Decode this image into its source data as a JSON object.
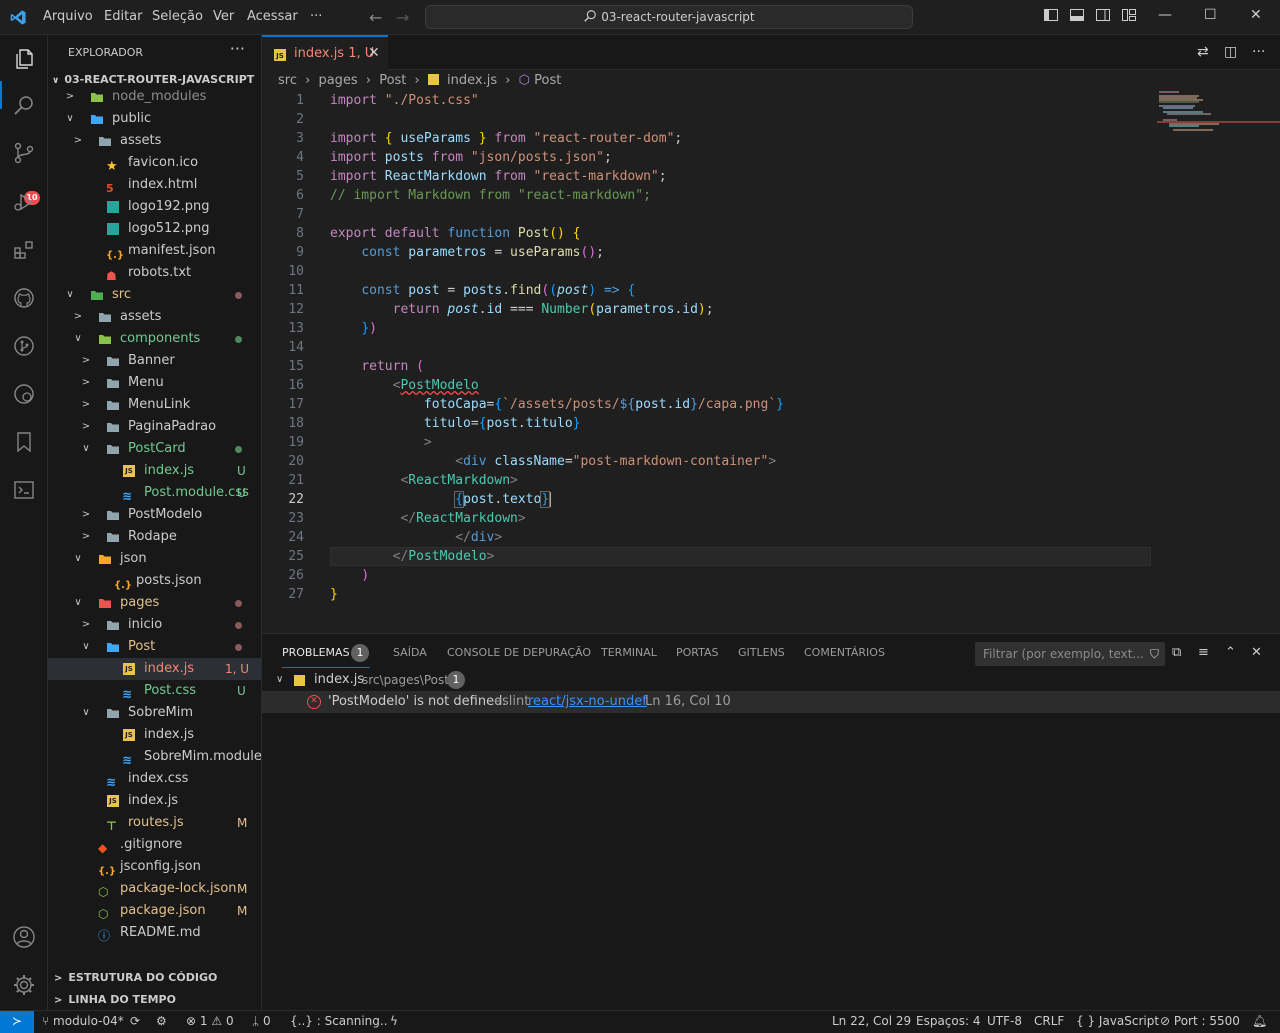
{
  "titlebar": {
    "menu": [
      "Arquivo",
      "Editar",
      "Seleção",
      "Ver",
      "Acessar"
    ],
    "more": "···",
    "command_center": "03-react-router-javascript"
  },
  "activity": {
    "scm_badge": "10"
  },
  "sidebar": {
    "title": "EXPLORADOR",
    "root": "03-REACT-ROUTER-JAVASCRIPT",
    "tree": [
      {
        "label": "node_modules",
        "status": ""
      },
      {
        "label": "public",
        "status": ""
      },
      {
        "label": "assets",
        "status": ""
      },
      {
        "label": "favicon.ico",
        "status": ""
      },
      {
        "label": "index.html",
        "status": ""
      },
      {
        "label": "logo192.png",
        "status": ""
      },
      {
        "label": "logo512.png",
        "status": ""
      },
      {
        "label": "manifest.json",
        "status": ""
      },
      {
        "label": "robots.txt",
        "status": ""
      },
      {
        "label": "src",
        "status": ""
      },
      {
        "label": "assets",
        "status": ""
      },
      {
        "label": "components",
        "status": ""
      },
      {
        "label": "Banner",
        "status": ""
      },
      {
        "label": "Menu",
        "status": ""
      },
      {
        "label": "MenuLink",
        "status": ""
      },
      {
        "label": "PaginaPadrao",
        "status": ""
      },
      {
        "label": "PostCard",
        "status": ""
      },
      {
        "label": "index.js",
        "status": "U"
      },
      {
        "label": "Post.module.css",
        "status": "U"
      },
      {
        "label": "PostModelo",
        "status": ""
      },
      {
        "label": "Rodape",
        "status": ""
      },
      {
        "label": "json",
        "status": ""
      },
      {
        "label": "posts.json",
        "status": ""
      },
      {
        "label": "pages",
        "status": ""
      },
      {
        "label": "inicio",
        "status": ""
      },
      {
        "label": "Post",
        "status": ""
      },
      {
        "label": "index.js",
        "status": "1, U"
      },
      {
        "label": "Post.css",
        "status": "U"
      },
      {
        "label": "SobreMim",
        "status": ""
      },
      {
        "label": "index.js",
        "status": ""
      },
      {
        "label": "SobreMim.module.css",
        "status": ""
      },
      {
        "label": "index.css",
        "status": ""
      },
      {
        "label": "index.js",
        "status": ""
      },
      {
        "label": "routes.js",
        "status": "M"
      },
      {
        "label": ".gitignore",
        "status": ""
      },
      {
        "label": "jsconfig.json",
        "status": ""
      },
      {
        "label": "package-lock.json",
        "status": "M"
      },
      {
        "label": "package.json",
        "status": "M"
      },
      {
        "label": "README.md",
        "status": ""
      }
    ],
    "sections": [
      "ESTRUTURA DO CÓDIGO",
      "LINHA DO TEMPO"
    ]
  },
  "editor": {
    "tab_label": "index.js 1, U",
    "breadcrumb": [
      "src",
      "pages",
      "Post",
      "index.js",
      "Post"
    ],
    "line_numbers": [
      "1",
      "2",
      "3",
      "4",
      "5",
      "6",
      "7",
      "8",
      "9",
      "10",
      "11",
      "12",
      "13",
      "14",
      "15",
      "16",
      "17",
      "18",
      "19",
      "20",
      "21",
      "22",
      "23",
      "24",
      "25",
      "26",
      "27"
    ],
    "current_line": "22"
  },
  "panel": {
    "tabs": [
      "PROBLEMAS",
      "SAÍDA",
      "CONSOLE DE DEPURAÇÃO",
      "TERMINAL",
      "PORTAS",
      "GITLENS",
      "COMENTÁRIOS"
    ],
    "problems_count": "1",
    "filter_placeholder": "Filtrar (por exemplo, text...",
    "file": "index.js",
    "file_path": "src\\pages\\Post",
    "file_count": "1",
    "message": "'PostModelo' is not defined.",
    "source": "eslint",
    "rule": "react/jsx-no-undef",
    "location": "Ln 16, Col 10"
  },
  "statusbar": {
    "branch": "modulo-04*",
    "errors": "1",
    "warnings": "0",
    "ports": "0",
    "scanning": "{..} : Scanning..",
    "position": "Ln 22, Col 29",
    "spaces": "Espaços: 4",
    "encoding": "UTF-8",
    "eol": "CRLF",
    "language": "JavaScript",
    "port": "Port : 5500"
  },
  "colors": {
    "accent": "#0078d4",
    "error": "#f14c4c",
    "modified": "#e2c08d",
    "untracked": "#73c991"
  }
}
